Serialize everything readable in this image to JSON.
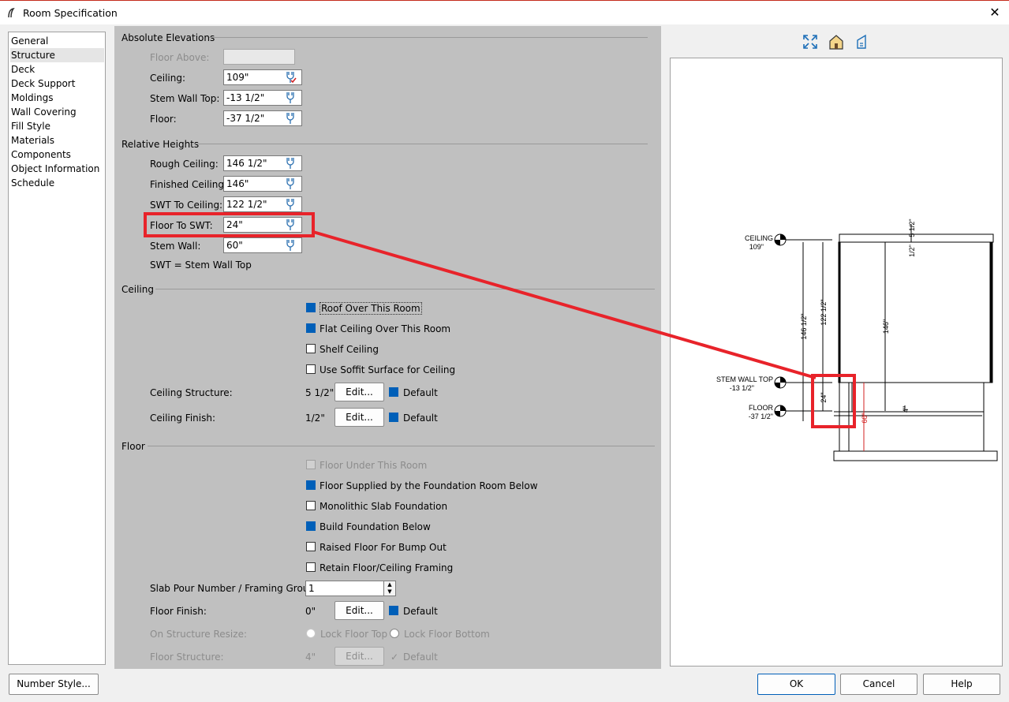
{
  "window": {
    "title": "Room Specification"
  },
  "sidebar": {
    "items": [
      "General",
      "Structure",
      "Deck",
      "Deck Support",
      "Moldings",
      "Wall Covering",
      "Fill Style",
      "Materials",
      "Components",
      "Object Information",
      "Schedule"
    ],
    "selected": "Structure"
  },
  "absolute": {
    "title": "Absolute Elevations",
    "floor_above_label": "Floor Above:",
    "floor_above_value": "",
    "ceiling_label": "Ceiling:",
    "ceiling_value": "109\"",
    "stem_wall_top_label": "Stem Wall Top:",
    "stem_wall_top_value": "-13 1/2\"",
    "floor_label": "Floor:",
    "floor_value": "-37 1/2\""
  },
  "relative": {
    "title": "Relative Heights",
    "rough_ceiling_label": "Rough Ceiling:",
    "rough_ceiling_value": "146 1/2\"",
    "finished_ceiling_label": "Finished Ceiling:",
    "finished_ceiling_value": "146\"",
    "swt_to_ceiling_label": "SWT To Ceiling:",
    "swt_to_ceiling_value": "122 1/2\"",
    "floor_to_swt_label": "Floor To SWT:",
    "floor_to_swt_value": "24\"",
    "stem_wall_label": "Stem Wall:",
    "stem_wall_value": "60\"",
    "note": "SWT = Stem Wall Top"
  },
  "ceiling": {
    "title": "Ceiling",
    "roof_over": "Roof Over This Room",
    "flat_ceiling": "Flat Ceiling Over This Room",
    "shelf_ceiling": "Shelf Ceiling",
    "soffit": "Use Soffit Surface for Ceiling",
    "structure_label": "Ceiling Structure:",
    "structure_value": "5 1/2\"",
    "finish_label": "Ceiling Finish:",
    "finish_value": "1/2\"",
    "edit_label": "Edit...",
    "default_label": "Default"
  },
  "floor": {
    "title": "Floor",
    "under_room": "Floor Under This Room",
    "supplied_by_foundation": "Floor Supplied by the Foundation Room Below",
    "monolithic": "Monolithic Slab Foundation",
    "build_foundation": "Build Foundation Below",
    "raised_floor": "Raised Floor For Bump Out",
    "retain_framing": "Retain Floor/Ceiling Framing",
    "slab_pour_label": "Slab Pour Number / Framing Group:",
    "slab_pour_value": "1",
    "finish_label": "Floor Finish:",
    "finish_value": "0\"",
    "resize_label": "On Structure Resize:",
    "lock_top": "Lock Floor Top",
    "lock_bottom": "Lock Floor Bottom",
    "structure_label": "Floor Structure:",
    "structure_value": "4\""
  },
  "preview": {
    "ceiling_label": "CEILING",
    "ceiling_value": "109\"",
    "stem_label": "STEM WALL TOP",
    "stem_value": "-13 1/2\"",
    "floor_label": "FLOOR",
    "floor_value": "-37 1/2\"",
    "dims": {
      "top_thickness": "5 1/2\"",
      "finish": "1/2\"",
      "rough": "146 1/2\"",
      "swt_ceiling": "122 1/2\"",
      "finished": "146\"",
      "floor_swt": "24\"",
      "stem": "60\"",
      "slab": "4\""
    }
  },
  "buttons": {
    "number_style": "Number Style...",
    "ok": "OK",
    "cancel": "Cancel",
    "help": "Help"
  },
  "colors": {
    "highlight": "#e8232a",
    "checkbox": "#005fb8",
    "panel": "#c0c0c0"
  }
}
